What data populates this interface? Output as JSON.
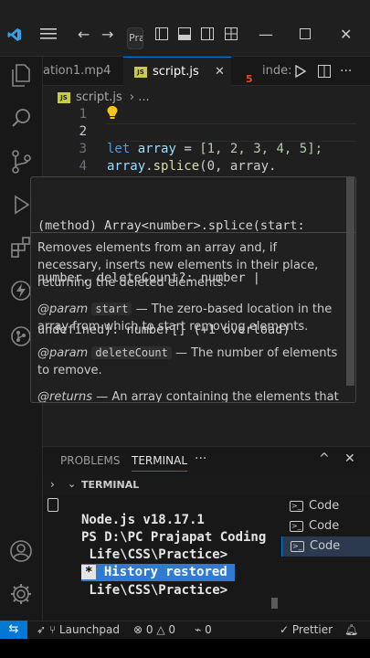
{
  "command_center": {
    "text": "Pra"
  },
  "tabs": [
    {
      "label": "ation1.mp4"
    },
    {
      "label": "script.js"
    },
    {
      "label": "inde:"
    }
  ],
  "breadcrumb": {
    "file": "script.js",
    "rest": "..."
  },
  "editor": {
    "line_numbers": [
      "1",
      "2",
      "3",
      "4"
    ],
    "line3": {
      "kw": "let",
      "var": "array",
      "eq": "=",
      "arr": "[1, 2, 3, 4, 5];"
    },
    "line4": {
      "obj": "array",
      "dot": ".",
      "fn": "splice",
      "args": "(0, array."
    }
  },
  "hover": {
    "signature_line1": "(method) Array<number>.splice(start:",
    "signature_line2": "number, deleteCount?: number |",
    "signature_line3": "undefined): number[] (+1 overload)",
    "description": "Removes elements from an array and, if necessary, inserts new elements in their place, returning the deleted elements.",
    "param1_tag": "@param",
    "param1_name": "start",
    "param1_desc": "— The zero-based location in the array from which to start removing elements.",
    "param2_tag": "@param",
    "param2_name": "deleteCount",
    "param2_desc": "— The number of elements to remove.",
    "returns_tag": "@returns",
    "returns_desc": "— An array containing the elements that"
  },
  "panel": {
    "tabs": [
      "PROBLEMS",
      "TERMINAL",
      "···"
    ],
    "section_label": "TERMINAL",
    "terminal_lines": [
      "Node.js v18.17.1",
      "PS D:\\PC Prajapat Coding",
      " Life\\CSS\\Practice>",
      " Life\\CSS\\Practice>"
    ],
    "history_marker": "*",
    "history_text": " History restored ",
    "terminal_list": [
      "Code",
      "Code",
      "Code"
    ]
  },
  "status": {
    "launchpad": "Launchpad",
    "errors": "0",
    "warnings": "0",
    "ports": "0",
    "prettier": "Prettier"
  },
  "colors": {
    "accent": "#0078d4",
    "keyword": "#569cd6",
    "variable": "#9cdcfe",
    "number": "#b5cea8",
    "function": "#dcdcaa"
  }
}
